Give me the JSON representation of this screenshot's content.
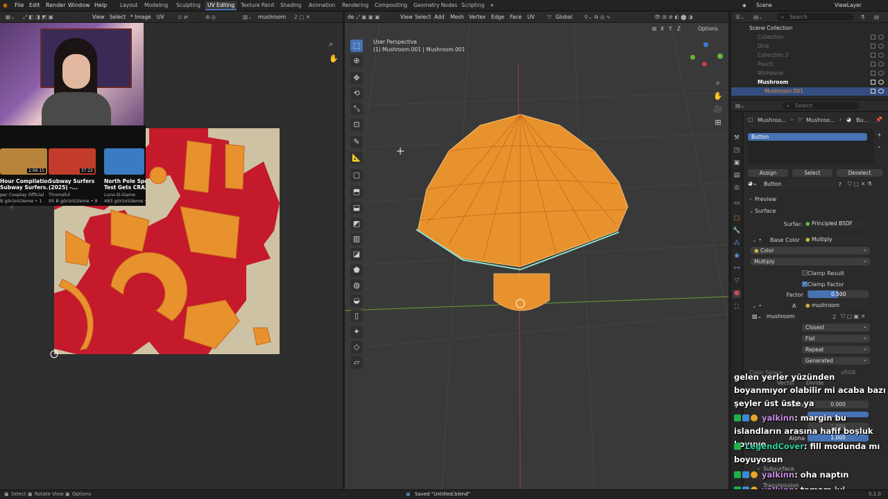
{
  "topbar": {
    "menus": [
      "File",
      "Edit",
      "Render",
      "Window",
      "Help"
    ],
    "workspaces": [
      "Layout",
      "Modeling",
      "Sculpting",
      "UV Editing",
      "Texture Paint",
      "Shading",
      "Animation",
      "Rendering",
      "Compositing",
      "Geometry Nodes",
      "Scripting"
    ],
    "active_workspace": "UV Editing",
    "scene": "Scene",
    "view_layer": "ViewLayer"
  },
  "uv_header": {
    "view": "View",
    "select": "Select",
    "image": "* Image",
    "uv": "UV",
    "image_name": "mushroom"
  },
  "vp_header": {
    "mode": "de",
    "view": "View",
    "select": "Select",
    "add": "Add",
    "mesh": "Mesh",
    "vertex": "Vertex",
    "edge": "Edge",
    "face": "Face",
    "uv": "UV",
    "orientation": "Global"
  },
  "viewport": {
    "perspective": "User Perspective",
    "object": "(1) Mushroom.001 | Mushroom.001",
    "options": "Options",
    "axes": [
      "X",
      "Y",
      "Z"
    ]
  },
  "outliner": {
    "search_placeholder": "Search",
    "root": "Scene Collection",
    "items": [
      "Collection",
      "Dice",
      "Collection 3",
      "Pouch",
      "Wishbone",
      "Mushroom",
      "Mushroom.001"
    ]
  },
  "properties": {
    "search_placeholder": "Search",
    "breadcrumb": [
      "Mushroo...",
      "Mushroo...",
      "Bu..."
    ],
    "slot": "Button",
    "assign": "Assign",
    "select": "Select",
    "deselect": "Deselect",
    "material": "Button",
    "material_users": "7",
    "preview": "Preview",
    "surface": "Surface",
    "surface_label": "Surface",
    "surface_value": "Principled BSDF",
    "base_color_label": "Base Color",
    "base_color_value": "Multiply",
    "color": "Color",
    "multiply": "Multiply",
    "clamp_result": "Clamp Result",
    "clamp_factor": "Clamp Factor",
    "factor_label": "Factor",
    "factor_value": "0.500",
    "a_label": "A",
    "a_value": "mushroom",
    "image_name": "mushroom",
    "image_users": "2",
    "interp": "Closest",
    "proj": "Flat",
    "ext": "Repeat",
    "source": "Generated",
    "color_space": "Color Space",
    "srgb": "sRGB",
    "vector": "Vector",
    "divide": "Divide",
    "metallic_label": "Metallic",
    "metallic_value": "0.000",
    "ior_value": "1.500",
    "alpha_label": "Alpha",
    "alpha_value": "1.000",
    "subsurface": "Subsurface",
    "transmission": "Transmission"
  },
  "youtube": [
    {
      "title": "Hour Compilation",
      "sub": "Subway Surfers...",
      "channel": "per Cosplay Official",
      "stats": "B görüntüleme • 1",
      "dur": "2:06:15",
      "color": "#b8833a"
    },
    {
      "title": "Subway Surfers",
      "sub": "(2025) -...",
      "channel": "Throneful",
      "stats": "95 B görüntüleme • 8",
      "dur": "37:22",
      "color": "#c33b2b"
    },
    {
      "title": "North Pole Spee",
      "sub": "Test Gets CRAZY",
      "channel": "Luno-D-Game",
      "stats": "483 görüntüleme •",
      "dur": "",
      "color": "#3a7bc4"
    }
  ],
  "chat": [
    {
      "user": "",
      "text": "gelen yerler yüzünden boyanmıyor olabilir mi acaba bazı şeyler üst üste ya",
      "color": "#ffffff"
    },
    {
      "user": "yalkinn",
      "text": ": margin bu islandların arasına hafif boşluk koyuyo",
      "color": "#c98be6"
    },
    {
      "user": "LegendCover",
      "text": ": fill modunda mı boyuyosun",
      "color": "#2fd4a0"
    },
    {
      "user": "yalkinn",
      "text": ": oha naptın",
      "color": "#c98be6"
    },
    {
      "user": "yalkinn",
      "text": ": tamam iyi",
      "color": "#c98be6"
    }
  ],
  "status": {
    "select": "Select",
    "rotate": "Rotate View",
    "options": "Options",
    "saved": "Saved \"Untitled.blend\"",
    "version": "5.1.0"
  },
  "colors": {
    "accent": "#4772b3",
    "mesh": "#e8922d",
    "uv_red": "#c41a2b",
    "uv_bg": "#cdc2a3"
  }
}
